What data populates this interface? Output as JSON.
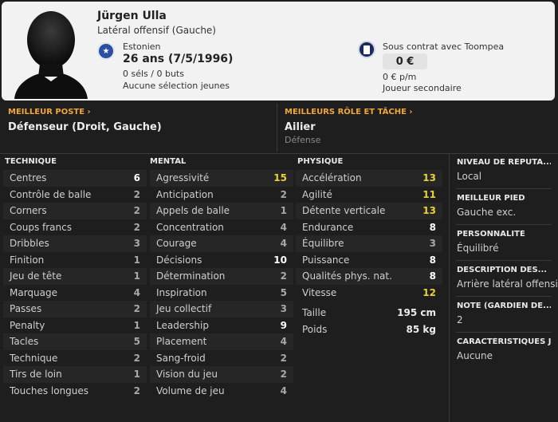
{
  "player": {
    "name": "Jürgen Ulla",
    "position": "Latéral offensif (Gauche)",
    "nationality": "Estonien",
    "age": "26 ans (7/5/1996)",
    "caps": "0 séls / 0 buts",
    "youth": "Aucune sélection jeunes",
    "contract": "Sous contrat avec Toompea",
    "value": "0 €",
    "wage": "0 € p/m",
    "status": "Joueur secondaire"
  },
  "best": {
    "position_label": "MEILLEUR POSTE",
    "position_value": "Défenseur (Droit, Gauche)",
    "role_label": "MEILLEURS RÔLE ET TÂCHE",
    "role_value": "Ailier",
    "role_duty": "Défense"
  },
  "technique": {
    "title": "TECHNIQUE",
    "attrs": [
      {
        "name": "Centres",
        "value": "6"
      },
      {
        "name": "Contrôle de balle",
        "value": "2"
      },
      {
        "name": "Corners",
        "value": "2"
      },
      {
        "name": "Coups francs",
        "value": "2"
      },
      {
        "name": "Dribbles",
        "value": "3"
      },
      {
        "name": "Finition",
        "value": "1"
      },
      {
        "name": "Jeu de tête",
        "value": "1"
      },
      {
        "name": "Marquage",
        "value": "4"
      },
      {
        "name": "Passes",
        "value": "2"
      },
      {
        "name": "Penalty",
        "value": "1"
      },
      {
        "name": "Tacles",
        "value": "5"
      },
      {
        "name": "Technique",
        "value": "2"
      },
      {
        "name": "Tirs de loin",
        "value": "1"
      },
      {
        "name": "Touches longues",
        "value": "2"
      }
    ]
  },
  "mental": {
    "title": "MENTAL",
    "attrs": [
      {
        "name": "Agressivité",
        "value": "15"
      },
      {
        "name": "Anticipation",
        "value": "2"
      },
      {
        "name": "Appels de balle",
        "value": "1"
      },
      {
        "name": "Concentration",
        "value": "4"
      },
      {
        "name": "Courage",
        "value": "4"
      },
      {
        "name": "Décisions",
        "value": "10"
      },
      {
        "name": "Détermination",
        "value": "2"
      },
      {
        "name": "Inspiration",
        "value": "5"
      },
      {
        "name": "Jeu collectif",
        "value": "3"
      },
      {
        "name": "Leadership",
        "value": "9"
      },
      {
        "name": "Placement",
        "value": "4"
      },
      {
        "name": "Sang-froid",
        "value": "2"
      },
      {
        "name": "Vision du jeu",
        "value": "2"
      },
      {
        "name": "Volume de jeu",
        "value": "4"
      }
    ]
  },
  "physique": {
    "title": "PHYSIQUE",
    "attrs": [
      {
        "name": "Accélération",
        "value": "13"
      },
      {
        "name": "Agilité",
        "value": "11"
      },
      {
        "name": "Détente verticale",
        "value": "13"
      },
      {
        "name": "Endurance",
        "value": "8"
      },
      {
        "name": "Équilibre",
        "value": "3"
      },
      {
        "name": "Puissance",
        "value": "8"
      },
      {
        "name": "Qualités phys. nat.",
        "value": "8"
      },
      {
        "name": "Vitesse",
        "value": "12"
      }
    ],
    "height_label": "Taille",
    "height_value": "195 cm",
    "weight_label": "Poids",
    "weight_value": "85 kg"
  },
  "side": [
    {
      "label": "NIVEAU DE RÉPUTA...",
      "value": "Local"
    },
    {
      "label": "MEILLEUR PIED",
      "value": "Gauche exc."
    },
    {
      "label": "PERSONNALITÉ",
      "value": "Équilibré"
    },
    {
      "label": "DESCRIPTION DES...",
      "value": "Arrière latéral offensif"
    },
    {
      "label": "NOTE (GARDIEN DE...",
      "value": "2"
    },
    {
      "label": "CARACTÉRISTIQUES J",
      "value": "Aucune"
    }
  ],
  "colors": {
    "accent": "#f0a63a",
    "yellow_value": "#e7d23a",
    "background": "#1e1e1e",
    "header_bg": "#f2f2f2"
  }
}
